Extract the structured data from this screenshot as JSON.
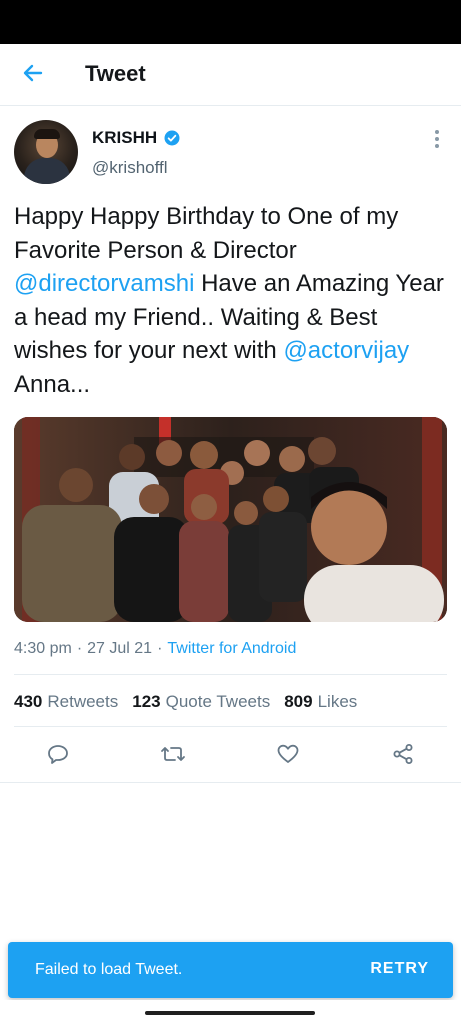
{
  "header": {
    "title": "Tweet"
  },
  "tweet": {
    "author_name": "KRISHH",
    "author_handle": "@krishoffl",
    "text": {
      "part1": "Happy Happy Birthday to One of my Favorite Person & Director ",
      "mention1": "@directorvamshi",
      "part2": " Have an Amazing Year a head my Friend.. Waiting & Best wishes for your next with ",
      "mention2": "@actorvijay",
      "part3": " Anna..."
    },
    "time": "4:30 pm",
    "date": "27 Jul 21",
    "source": "Twitter for Android",
    "separator": "·"
  },
  "stats": {
    "retweets_count": "430",
    "retweets_label": "Retweets",
    "quotes_count": "123",
    "quotes_label": "Quote Tweets",
    "likes_count": "809",
    "likes_label": "Likes"
  },
  "snackbar": {
    "message": "Failed to load Tweet.",
    "action": "RETRY"
  },
  "colors": {
    "accent": "#1da1f2",
    "text": "#14171a",
    "secondary": "#657786"
  },
  "icons": {
    "back": "arrow-left-icon",
    "verified": "verified-badge-icon",
    "more": "more-vertical-icon",
    "reply": "reply-icon",
    "retweet": "retweet-icon",
    "like": "heart-icon",
    "share": "share-icon"
  }
}
